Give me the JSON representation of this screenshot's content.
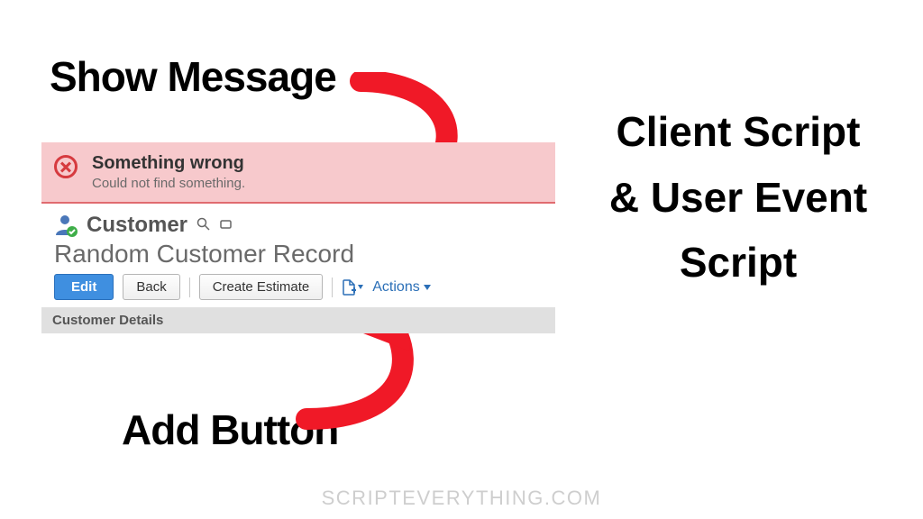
{
  "annotations": {
    "show_message": "Show Message",
    "add_button": "Add Button"
  },
  "right_title": "Client Script & User Event Script",
  "watermark": "SCRIPTEVERYTHING.COM",
  "error_banner": {
    "title": "Something wrong",
    "subtitle": "Could not find something."
  },
  "record": {
    "type_label": "Customer",
    "title": "Random Customer Record",
    "buttons": {
      "edit": "Edit",
      "back": "Back",
      "create_estimate": "Create Estimate"
    },
    "actions_label": "Actions",
    "section_header": "Customer Details"
  }
}
